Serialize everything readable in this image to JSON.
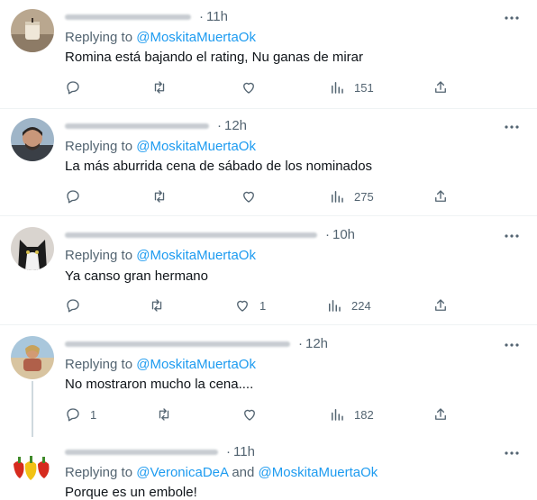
{
  "colors": {
    "accent": "#1d9bf0",
    "muted": "#536471",
    "text": "#0f1419",
    "divider": "#eff3f4"
  },
  "icons": {
    "reply": "reply-icon",
    "retweet": "retweet-icon",
    "like": "heart-icon",
    "views": "views-icon",
    "share": "share-icon",
    "more": "more-icon"
  },
  "replying_prefix": "Replying to",
  "and_word": "and",
  "tweets": [
    {
      "time": "11h",
      "mentions": [
        "@MoskitaMuertaOk"
      ],
      "text": "Romina está bajando el rating, Nu ganas de mirar",
      "replies": "",
      "retweets": "",
      "likes": "",
      "views": "151"
    },
    {
      "time": "12h",
      "mentions": [
        "@MoskitaMuertaOk"
      ],
      "text": "La más aburrida cena de sábado de los nominados",
      "replies": "",
      "retweets": "",
      "likes": "",
      "views": "275"
    },
    {
      "time": "10h",
      "mentions": [
        "@MoskitaMuertaOk"
      ],
      "text": "Ya canso gran hermano",
      "replies": "",
      "retweets": "",
      "likes": "1",
      "views": "224"
    },
    {
      "time": "12h",
      "mentions": [
        "@MoskitaMuertaOk"
      ],
      "text": "No mostraron mucho la cena....",
      "replies": "1",
      "retweets": "",
      "likes": "",
      "views": "182"
    },
    {
      "time": "11h",
      "mentions": [
        "@VeronicaDeA",
        "@MoskitaMuertaOk"
      ],
      "text": "Porque es un embole!"
    }
  ]
}
